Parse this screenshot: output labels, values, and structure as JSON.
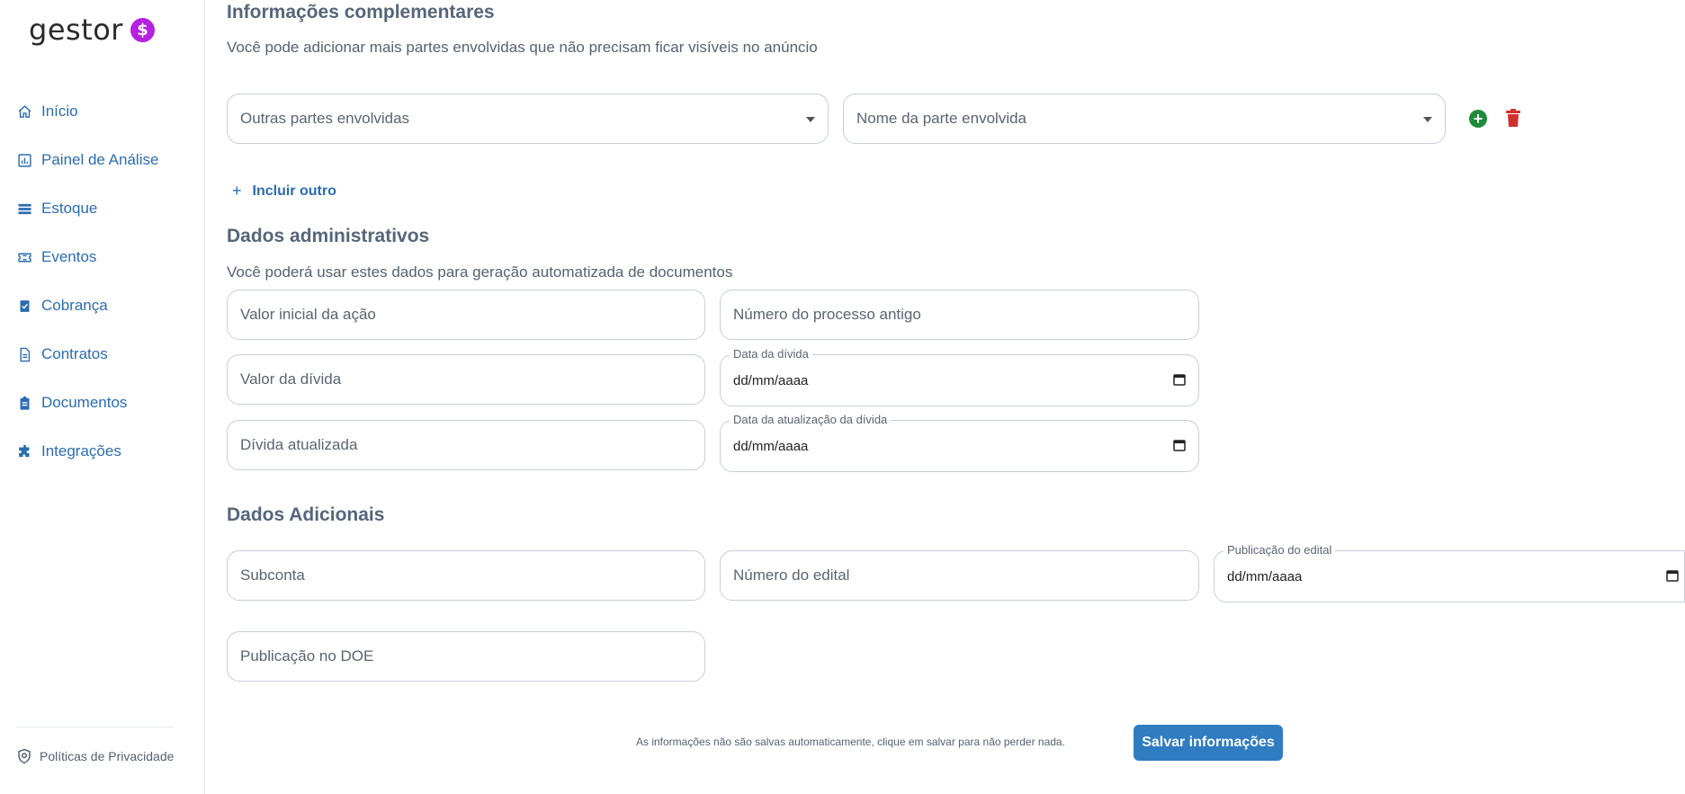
{
  "brand": {
    "logo_text": "gestor",
    "coin_symbol": "$"
  },
  "sidebar": {
    "items": [
      {
        "label": "Início",
        "icon": "home-icon"
      },
      {
        "label": "Painel de Análise",
        "icon": "chart-icon"
      },
      {
        "label": "Estoque",
        "icon": "list-icon"
      },
      {
        "label": "Eventos",
        "icon": "ticket-icon"
      },
      {
        "label": "Cobrança",
        "icon": "clipboard-check-icon"
      },
      {
        "label": "Contratos",
        "icon": "file-icon"
      },
      {
        "label": "Documentos",
        "icon": "clipboard-icon"
      },
      {
        "label": "Integrações",
        "icon": "puzzle-icon"
      }
    ],
    "privacy": {
      "label": "Políticas de Privacidade",
      "icon": "shield-icon"
    }
  },
  "complementares": {
    "title": "Informações complementares",
    "subtitle": "Você pode adicionar mais partes envolvidas que não precisam ficar visíveis no anúncio",
    "select_outras": "Outras partes envolvidas",
    "select_nome": "Nome da parte envolvida",
    "add_label": "+",
    "include_plus": "+",
    "include_label": "Incluir outro"
  },
  "administrativos": {
    "title": "Dados administrativos",
    "subtitle": "Você poderá usar estes dados para geração automatizada de documentos",
    "valor_inicial": "Valor inicial da ação",
    "numero_processo": "Número do processo antigo",
    "valor_divida": "Valor da dívida",
    "data_divida_label": "Data da dívida",
    "data_divida_value": "dd/mm/aaaa",
    "divida_atualizada": "Dívida atualizada",
    "data_atualizacao_label": "Data da atualização da dívida",
    "data_atualizacao_value": "dd/mm/aaaa"
  },
  "adicionais": {
    "title": "Dados Adicionais",
    "subconta": "Subconta",
    "numero_edital": "Número do edital",
    "publicacao_edital_label": "Publicação do edital",
    "publicacao_edital_value": "dd/mm/aaaa",
    "publicacao_doe": "Publicação no DOE"
  },
  "footer": {
    "note": "As informações não são salvas automaticamente, clique em salvar para não perder nada.",
    "save_label": "Salvar informações"
  },
  "colors": {
    "accent": "#2f7cc1",
    "nav_link": "#2b6cb0",
    "add_green": "#1f8a3a",
    "delete_red": "#d32f2f",
    "coin": "#b620e0"
  }
}
